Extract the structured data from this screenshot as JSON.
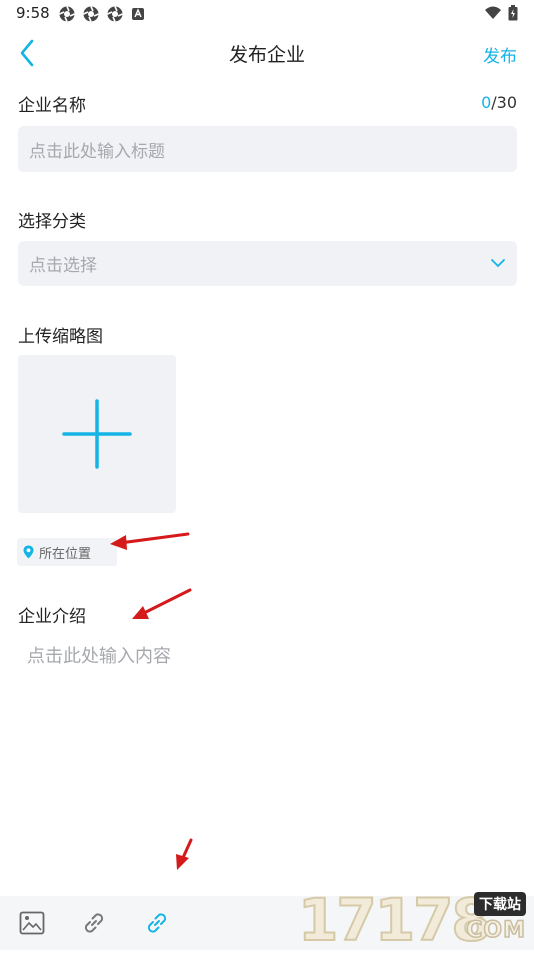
{
  "status_bar": {
    "time": "9:58"
  },
  "header": {
    "title": "发布企业",
    "publish_label": "发布"
  },
  "company_name": {
    "label": "企业名称",
    "counter_current": "0",
    "counter_max": "/30",
    "placeholder": "点击此处输入标题"
  },
  "category": {
    "label": "选择分类",
    "placeholder": "点击选择"
  },
  "thumbnail": {
    "label": "上传缩略图"
  },
  "location": {
    "label": "所在位置"
  },
  "intro": {
    "label": "企业介绍",
    "placeholder": "点击此处输入内容"
  },
  "toolbar": {
    "items": [
      "image-icon",
      "link-icon",
      "link-icon-active"
    ]
  },
  "watermark": {
    "digits": "17178",
    "tag": "下载站",
    "suffix": "COM"
  },
  "colors": {
    "accent": "#14b4e6",
    "input_bg": "#f0f2f5",
    "placeholder": "#a6a8ad",
    "arrow": "#d41a1a"
  }
}
